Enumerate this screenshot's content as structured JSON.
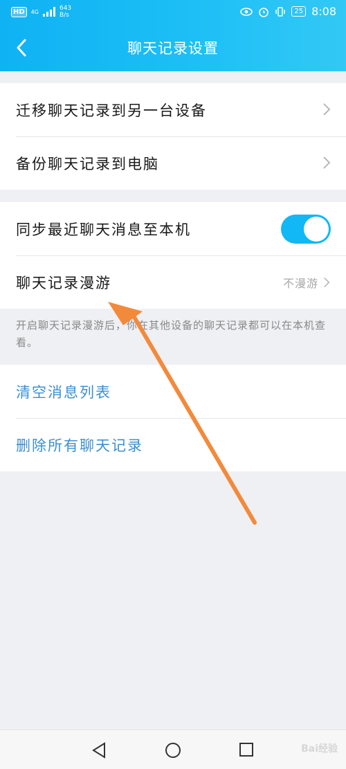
{
  "status_bar": {
    "hd": "HD",
    "network": "4G",
    "speed_value": "643",
    "speed_unit": "B/s",
    "battery": "25",
    "time": "8:08"
  },
  "header": {
    "title": "聊天记录设置"
  },
  "group1": [
    {
      "label": "迁移聊天记录到另一台设备"
    },
    {
      "label": "备份聊天记录到电脑"
    }
  ],
  "group2": {
    "sync": {
      "label": "同步最近聊天消息至本机",
      "enabled": true
    },
    "roaming": {
      "label": "聊天记录漫游",
      "value": "不漫游"
    },
    "hint": "开启聊天记录漫游后，你在其他设备的聊天记录都可以在本机查看。"
  },
  "group3": [
    {
      "label": "清空消息列表"
    },
    {
      "label": "删除所有聊天记录"
    }
  ],
  "colors": {
    "accent": "#12b7f5",
    "link_blue": "#3d8fd0",
    "annotation_arrow": "#f28a3c"
  },
  "watermark": "Bai经验"
}
